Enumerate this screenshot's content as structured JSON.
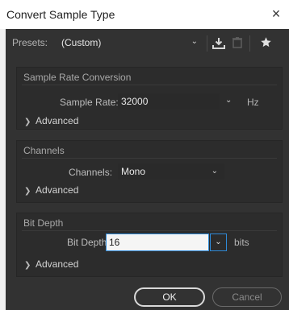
{
  "window": {
    "title": "Convert Sample Type",
    "close_glyph": "×"
  },
  "presets": {
    "label": "Presets:",
    "value": "(Custom)",
    "icons": [
      "download-icon",
      "trash-icon",
      "star-icon"
    ]
  },
  "sample_rate": {
    "section_title": "Sample Rate Conversion",
    "field_label": "Sample Rate:",
    "value": "32000",
    "unit": "Hz",
    "advanced_label": "Advanced"
  },
  "channels": {
    "section_title": "Channels",
    "field_label": "Channels:",
    "value": "Mono",
    "advanced_label": "Advanced"
  },
  "bit_depth": {
    "section_title": "Bit Depth",
    "field_label": "Bit Depth:",
    "value": "16",
    "unit": "bits",
    "advanced_label": "Advanced"
  },
  "buttons": {
    "ok": "OK",
    "cancel": "Cancel"
  },
  "colors": {
    "dialog_bg": "#323232",
    "panel_bg": "#2c2c2c",
    "accent": "#2f8ad8"
  }
}
